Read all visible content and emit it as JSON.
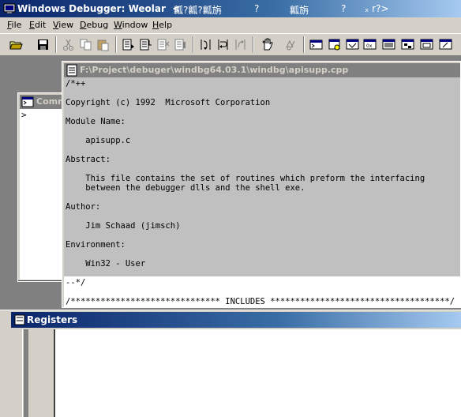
{
  "titlebar": {
    "title": "Windows Debugger: Weolar  <",
    "garble": [
      "瓤?瓤?瓤旃",
      "?",
      "瓤旃",
      "?",
      "ₓ r?>"
    ]
  },
  "menu": [
    {
      "label": "File",
      "key": "F"
    },
    {
      "label": "Edit",
      "key": "E"
    },
    {
      "label": "View",
      "key": "V"
    },
    {
      "label": "Debug",
      "key": "D"
    },
    {
      "label": "Window",
      "key": "W"
    },
    {
      "label": "Help",
      "key": "H"
    }
  ],
  "toolbar": {
    "buttons": [
      "open-icon",
      "save-icon",
      "cut-icon",
      "copy-icon",
      "paste-icon",
      "go-icon",
      "restart-icon",
      "stop-debugging-icon",
      "break-icon",
      "step-into-icon",
      "step-over-icon",
      "step-out-icon",
      "hand-icon",
      "run-to-cursor-icon",
      "command-window-icon",
      "watch-window-icon",
      "locals-icon",
      "registers-icon",
      "memory-icon",
      "call-stack-icon",
      "disassembly-icon",
      "scratch-icon"
    ]
  },
  "command_window": {
    "title": "Comm",
    "prompt": ">"
  },
  "source_window": {
    "title": "F:\\Project\\debuger\\windbg64.03.1\\windbg\\apisupp.cpp",
    "lines": [
      "/*++",
      "",
      "Copyright (c) 1992  Microsoft Corporation",
      "",
      "Module Name:",
      "",
      "    apisupp.c",
      "",
      "Abstract:",
      "",
      "    This file contains the set of routines which preform the interfacing",
      "    between the debugger dlls and the shell exe.",
      "",
      "Author:",
      "",
      "    Jim Schaad (jimsch)",
      "",
      "Environment:",
      "",
      "    Win32 - User",
      "",
      "--*/",
      "",
      "/****************************** INCLUDES ************************************/"
    ]
  },
  "registers_window": {
    "title": "Registers"
  }
}
